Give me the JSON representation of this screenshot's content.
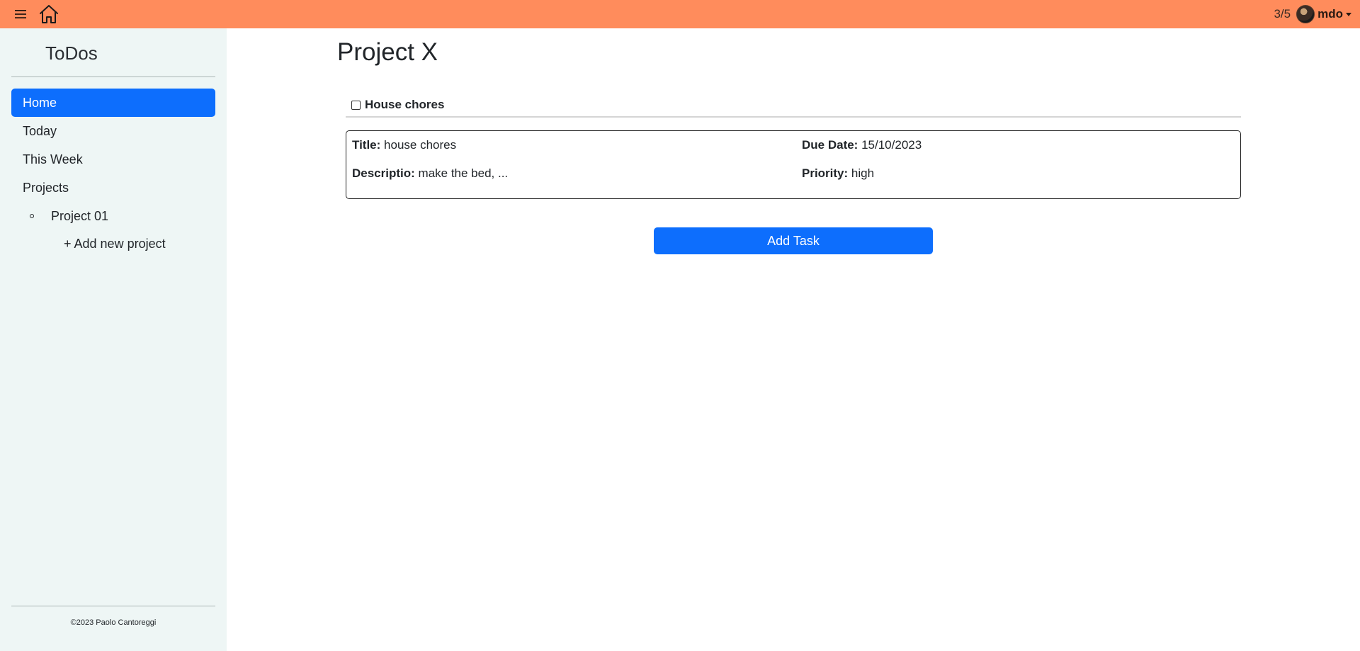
{
  "topbar": {
    "background_color": "#ff8c5c",
    "menu_icon": "hamburger-icon",
    "home_icon": "house-icon",
    "progress": "3/5",
    "username": "mdo"
  },
  "sidebar": {
    "background_color": "#eef6f5",
    "brand": "ToDos",
    "nav": [
      {
        "label": "Home",
        "active": true
      },
      {
        "label": "Today",
        "active": false
      },
      {
        "label": "This Week",
        "active": false
      },
      {
        "label": "Projects",
        "active": false
      }
    ],
    "projects": [
      "Project 01"
    ],
    "add_project": "+ Add new project",
    "footer": "©2023 Paolo Cantoreggi"
  },
  "main": {
    "title": "Project X",
    "task": {
      "name": "House chores",
      "checked": false,
      "title_label": "Title:",
      "title_value": "house chores",
      "due_label": "Due Date:",
      "due_value": "15/10/2023",
      "description_label": "Descriptio:",
      "description_value": "make the bed, ...",
      "priority_label": "Priority:",
      "priority_value": "high"
    },
    "add_task_label": "Add Task",
    "accent_color": "#0d6efd"
  }
}
